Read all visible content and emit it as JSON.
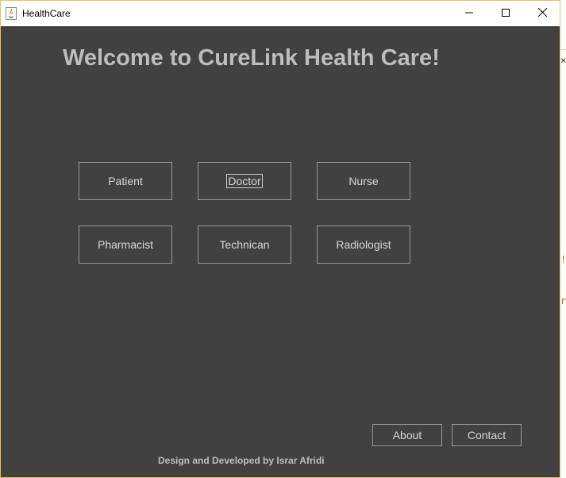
{
  "window": {
    "title": "HealthCare",
    "controls": {
      "minimize_icon": "minimize-icon",
      "maximize_icon": "maximize-icon",
      "close_icon": "close-icon"
    }
  },
  "main": {
    "heading": "Welcome to CureLink Health Care!",
    "roles": [
      {
        "label": "Patient"
      },
      {
        "label": "Doctor"
      },
      {
        "label": "Nurse"
      },
      {
        "label": "Pharmacist"
      },
      {
        "label": "Technican"
      },
      {
        "label": "Radiologist"
      }
    ],
    "focused_role": "Doctor",
    "about_label": "About",
    "contact_label": "Contact",
    "footer": "Design and Developed by Israr Afridi"
  },
  "background_app": {
    "glyphs": [
      "×",
      "!",
      "r"
    ]
  },
  "colors": {
    "content_background": "#414141",
    "heading_text": "#bdbdbd",
    "button_border": "#8e9aa5",
    "button_text": "#d6d6d6",
    "window_border": "#e8c25a",
    "background_glyph_orange": "#b5651d"
  }
}
